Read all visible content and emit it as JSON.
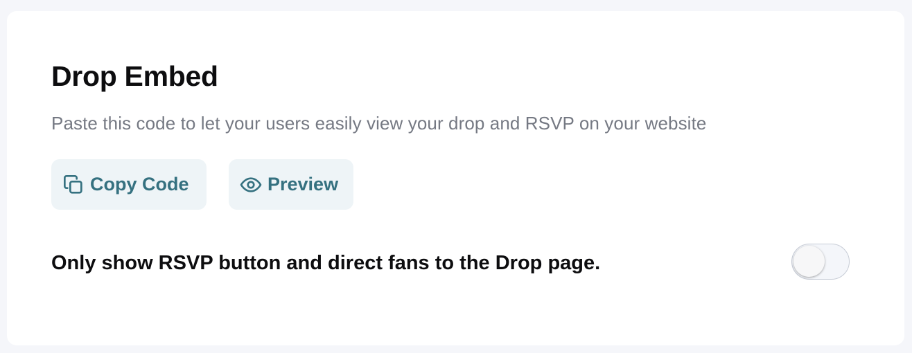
{
  "card": {
    "title": "Drop Embed",
    "subtitle": "Paste this code to let your users easily view your drop and RSVP on your website"
  },
  "actions": {
    "copy_label": "Copy Code",
    "copy_icon": "copy-icon",
    "preview_label": "Preview",
    "preview_icon": "eye-icon"
  },
  "setting": {
    "label": "Only show RSVP button and direct fans to the Drop page.",
    "enabled": false
  },
  "colors": {
    "accent": "#357180",
    "button_bg": "#eef4f7",
    "text_primary": "#0d0d0f",
    "text_secondary": "#757983",
    "page_bg": "#f5f6fa"
  }
}
